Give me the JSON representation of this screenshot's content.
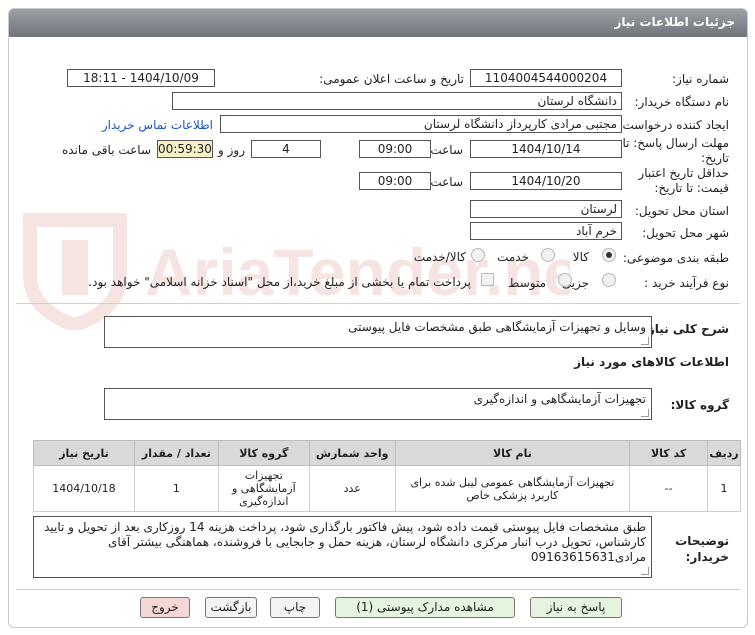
{
  "header": {
    "title": "جزئیات اطلاعات نیاز"
  },
  "form": {
    "need_number": {
      "label": "شماره نیاز:",
      "value": "1104004544000204"
    },
    "announce_datetime": {
      "label": "تاریخ و ساعت اعلان عمومی:",
      "value": "1404/10/09 - 18:11"
    },
    "buyer_org": {
      "label": "نام دستگاه خریدار:",
      "value": "دانشگاه لرستان"
    },
    "creator": {
      "label": "ایجاد کننده درخواست:",
      "value": "مجتبی مرادی کارپرداز دانشگاه لرستان",
      "contact_link": "اطلاعات تماس خریدار"
    },
    "response_deadline": {
      "label": "مهلت ارسال پاسخ: تا تاریخ:",
      "date": "1404/10/14",
      "time_label": "ساعت",
      "time": "09:00",
      "days": "4",
      "days_label": "روز و",
      "remaining": "00:59:30",
      "remaining_label": "ساعت باقی مانده"
    },
    "price_validity": {
      "label": "حداقل تاریخ اعتبار قیمت: تا تاریخ:",
      "date": "1404/10/20",
      "time_label": "ساعت",
      "time": "09:00"
    },
    "province": {
      "label": "استان محل تحویل:",
      "value": "لرستان"
    },
    "city": {
      "label": "شهر محل تحویل:",
      "value": "خرم آباد"
    },
    "category": {
      "label": "طبقه بندی موضوعی:",
      "options": [
        "کالا",
        "خدمت",
        "کالا/خدمت"
      ],
      "selected": "کالا"
    },
    "purchase_type": {
      "label": "نوع فرآیند خرید :",
      "options": [
        "جزیی",
        "متوسط"
      ],
      "selected": "",
      "payment_note": "پرداخت تمام یا بخشی از مبلغ خرید،از محل \"اسناد خزانه اسلامی\" خواهد بود."
    }
  },
  "summary": {
    "label": "شرح کلی نیاز:",
    "value": "وسایل و تجهیزات آزمایشگاهی طبق مشخصات فایل پیوستی"
  },
  "goods_section_title": "اطلاعات کالاهای مورد نیاز",
  "goods_group": {
    "label": "گروه کالا:",
    "value": "تجهیزات آزمایشگاهی و اندازه‌گیری"
  },
  "table": {
    "headers": [
      "ردیف",
      "کد کالا",
      "نام کالا",
      "واحد شمارش",
      "گروه کالا",
      "تعداد / مقدار",
      "تاریخ نیاز"
    ],
    "rows": [
      {
        "row": "1",
        "code": "--",
        "name": "تجهیزات آزمایشگاهی عمومی لیبل شده برای کاربرد پزشکی خاص",
        "unit": "عدد",
        "group": "تجهیزات آزمایشگاهی و اندازه‌گیری",
        "qty": "1",
        "date": "1404/10/18"
      }
    ]
  },
  "buyer_notes": {
    "label": "توضیحات خریدار:",
    "value": "طبق مشخصات فایل پیوستی قیمت داده شود، پیش فاکتور بارگذاری شود، پرداخت هزینه 14 روزکاری بعد از تحویل و تایید کارشناس، تحویل درب انبار مرکزی دانشگاه لرستان،  هزینه حمل و جابجایی با فروشنده، هماهنگی بیشتر آقای مرادی09163615631"
  },
  "buttons": {
    "reply": "پاسخ به نیاز",
    "view_docs": "مشاهده مدارک پیوستی (1)",
    "print": "چاپ",
    "back": "بازگشت",
    "exit": "خروج"
  },
  "watermark": {
    "text": "AriaTender.neT"
  },
  "colors": {
    "header": "#7d8389",
    "link": "#1a55c8",
    "remaining_bg": "#f7f1c7",
    "exit_bg": "#f6d7d7",
    "reply_bg": "#e6f3df"
  }
}
